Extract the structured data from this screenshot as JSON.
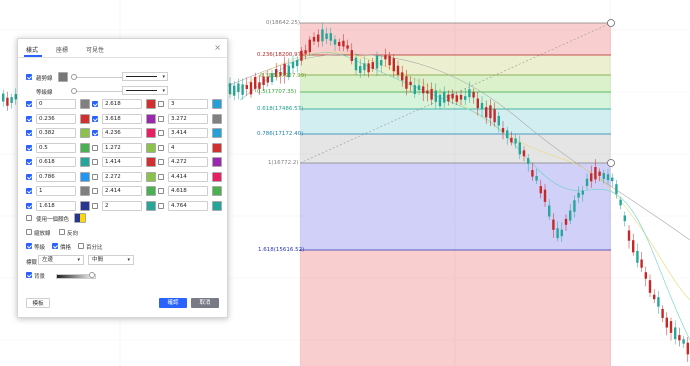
{
  "fib_levels": [
    {
      "label": "0(18642.25)",
      "color": "#808080"
    },
    {
      "label": "0.236(18200.97)",
      "color": "#b22828"
    },
    {
      "label": "0.382(17927.99)",
      "color": "#6f9b2b"
    },
    {
      "label": "0.5(17707.35)",
      "color": "#3ba53b"
    },
    {
      "label": "0.618(17486.57)",
      "color": "#1f9c8c"
    },
    {
      "label": "0.786(17172.40)",
      "color": "#1f7fb0"
    },
    {
      "label": "1(16772.2)",
      "color": "#808080"
    },
    {
      "label": "1.618(15616.52)",
      "color": "#2a35b5"
    }
  ],
  "dialog": {
    "tabs": [
      "樣式",
      "座標",
      "可見性"
    ],
    "active_tab": "樣式",
    "close_icon": "close-icon",
    "trend_line_label": "趨勢線",
    "levels_line_label": "等級線",
    "levels_left": [
      {
        "value": "0",
        "checked": true,
        "color": "#808080"
      },
      {
        "value": "0.236",
        "checked": true,
        "color": "#d32f2f"
      },
      {
        "value": "0.382",
        "checked": true,
        "color": "#8bc34a"
      },
      {
        "value": "0.5",
        "checked": true,
        "color": "#4caf50"
      },
      {
        "value": "0.618",
        "checked": true,
        "color": "#26a69a"
      },
      {
        "value": "0.786",
        "checked": true,
        "color": "#2196f3"
      },
      {
        "value": "1",
        "checked": true,
        "color": "#808080"
      },
      {
        "value": "1.618",
        "checked": true,
        "color": "#283593"
      }
    ],
    "levels_mid": [
      {
        "value": "2.618",
        "checked": true,
        "color": "#d32f2f"
      },
      {
        "value": "3.618",
        "checked": true,
        "color": "#9c27b0"
      },
      {
        "value": "4.236",
        "checked": true,
        "color": "#e91e63"
      },
      {
        "value": "1.272",
        "checked": false,
        "color": "#8bc34a"
      },
      {
        "value": "1.414",
        "checked": false,
        "color": "#d32f2f"
      },
      {
        "value": "2.272",
        "checked": false,
        "color": "#8bc34a"
      },
      {
        "value": "2.414",
        "checked": false,
        "color": "#4caf50"
      },
      {
        "value": "2",
        "checked": false,
        "color": "#26a69a"
      }
    ],
    "levels_right": [
      {
        "value": "3",
        "checked": false,
        "color": "#26a0d8"
      },
      {
        "value": "3.272",
        "checked": false,
        "color": "#808080"
      },
      {
        "value": "3.414",
        "checked": false,
        "color": "#26a0d8"
      },
      {
        "value": "4",
        "checked": false,
        "color": "#d32f2f"
      },
      {
        "value": "4.272",
        "checked": false,
        "color": "#9c27b0"
      },
      {
        "value": "4.414",
        "checked": false,
        "color": "#e91e63"
      },
      {
        "value": "4.618",
        "checked": false,
        "color": "#4caf50"
      },
      {
        "value": "4.764",
        "checked": false,
        "color": "#26a69a"
      }
    ],
    "one_color_label": "使用一個顏色",
    "log_scale_label": "縮放線",
    "reverse_label": "反向",
    "levels_label": "等級",
    "prices_label": "價格",
    "percent_label": "百分比",
    "labels_label": "標籤",
    "labels_h_value": "左邊",
    "labels_v_value": "中間",
    "background_label": "背景",
    "default_button": "模板",
    "ok_button": "確認",
    "cancel_button": "取消"
  }
}
